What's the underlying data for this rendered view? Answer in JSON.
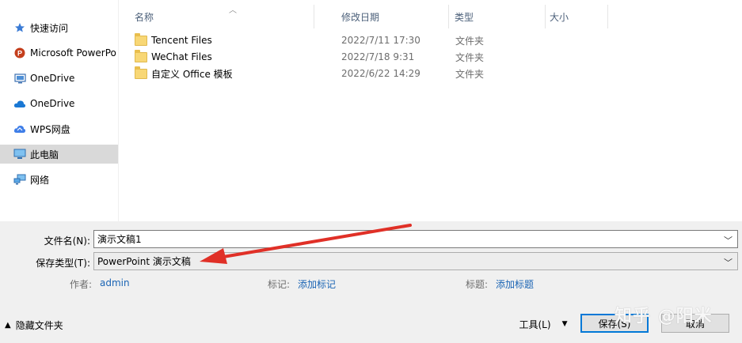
{
  "nav": {
    "items": [
      {
        "label": "快速访问",
        "icon": "pin-icon"
      },
      {
        "label": "Microsoft PowerPo",
        "icon": "powerpoint-icon"
      },
      {
        "label": "OneDrive",
        "icon": "onedrive-computer-icon"
      },
      {
        "label": "OneDrive",
        "icon": "onedrive-cloud-icon"
      },
      {
        "label": "WPS网盘",
        "icon": "wps-cloud-icon"
      },
      {
        "label": "此电脑",
        "icon": "this-pc-icon"
      },
      {
        "label": "网络",
        "icon": "network-icon"
      }
    ]
  },
  "columns": {
    "name": "名称",
    "date": "修改日期",
    "type": "类型",
    "size": "大小"
  },
  "files": [
    {
      "name": "Tencent Files",
      "date": "2022/7/11 17:30",
      "type": "文件夹"
    },
    {
      "name": "WeChat Files",
      "date": "2022/7/18 9:31",
      "type": "文件夹"
    },
    {
      "name": "自定义 Office 模板",
      "date": "2022/6/22 14:29",
      "type": "文件夹"
    }
  ],
  "form": {
    "filename_label": "文件名(N):",
    "filename_value": "演示文稿1",
    "filetype_label": "保存类型(T):",
    "filetype_value": "PowerPoint 演示文稿"
  },
  "meta": {
    "author_label": "作者:",
    "author_value": "admin",
    "tags_label": "标记:",
    "tags_value": "添加标记",
    "title_label": "标题:",
    "title_value": "添加标题"
  },
  "footer": {
    "hide_folders": "隐藏文件夹",
    "tools": "工具(L)",
    "save": "保存(S)",
    "cancel": "取消"
  },
  "watermark": "知乎 @阳米",
  "colors": {
    "accent": "#0078d7",
    "link": "#1a64b4",
    "arrow": "#e03027"
  }
}
